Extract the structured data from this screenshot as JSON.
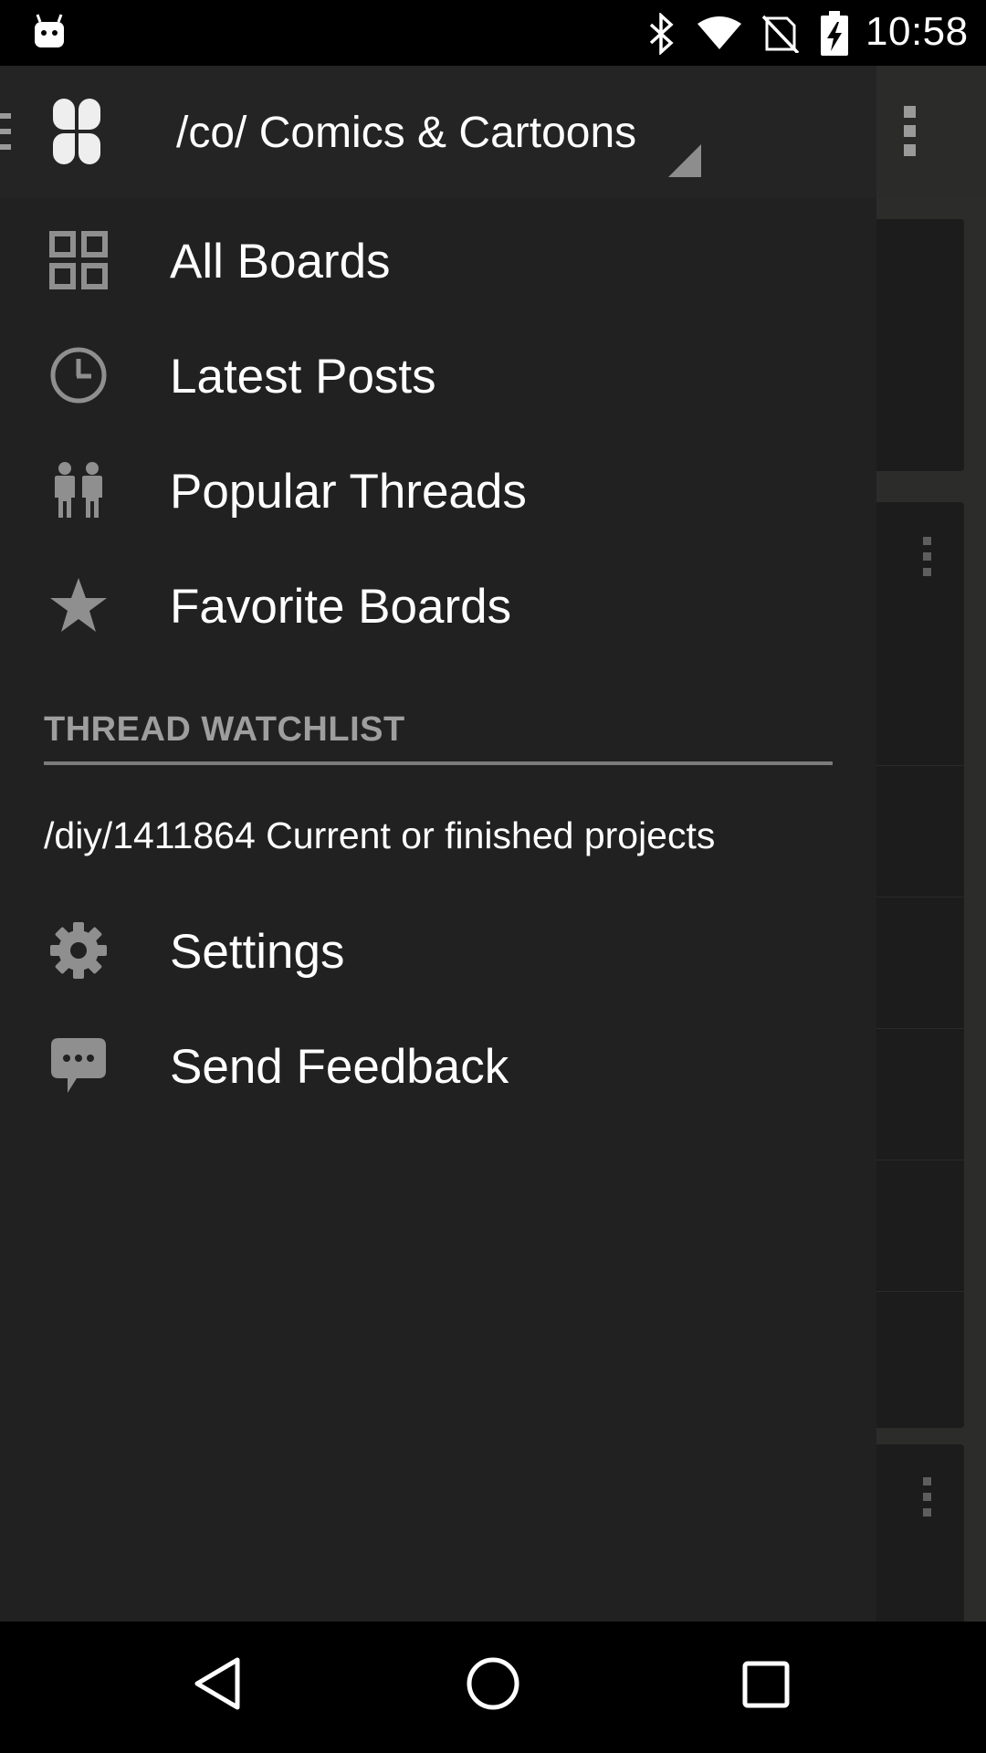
{
  "status_bar": {
    "time": "10:58",
    "icons": [
      "android-notification-icon",
      "bluetooth-icon",
      "wifi-icon",
      "no-sim-signal-icon",
      "battery-charging-icon"
    ]
  },
  "drawer": {
    "board_selector": {
      "selected": "/co/ Comics & Cartoons"
    },
    "nav_items": [
      {
        "label": "All Boards",
        "icon": "grid-icon"
      },
      {
        "label": "Latest Posts",
        "icon": "clock-icon"
      },
      {
        "label": "Popular Threads",
        "icon": "people-icon"
      },
      {
        "label": "Favorite Boards",
        "icon": "star-icon"
      }
    ],
    "watchlist": {
      "header": "THREAD WATCHLIST",
      "items": [
        {
          "label": "/diy/1411864  Current or finished projects"
        }
      ]
    },
    "footer_items": [
      {
        "label": "Settings",
        "icon": "gear-icon"
      },
      {
        "label": "Send Feedback",
        "icon": "chat-bubble-icon"
      }
    ]
  },
  "nav_bar": {
    "buttons": [
      "back-icon",
      "home-icon",
      "recents-icon"
    ]
  },
  "colors": {
    "drawer_bg": "#202120",
    "header_bg": "#232423",
    "text": "#ffffff",
    "muted": "#9e9e9e",
    "icon": "#8f8f8f"
  }
}
